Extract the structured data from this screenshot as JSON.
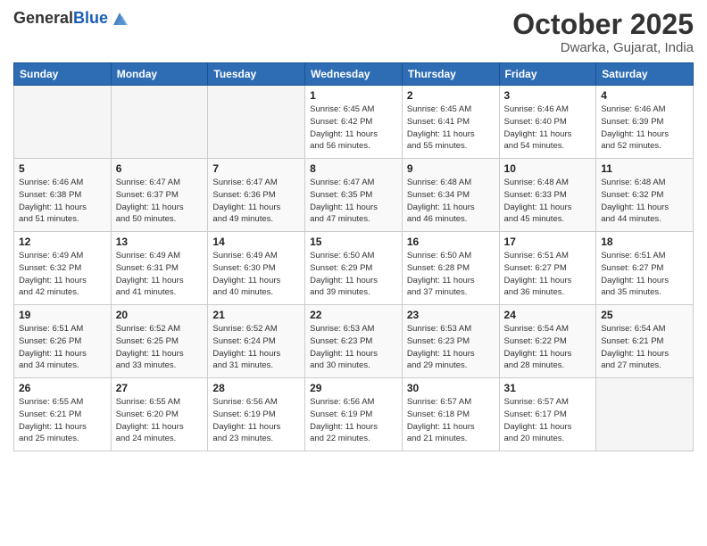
{
  "logo": {
    "general": "General",
    "blue": "Blue"
  },
  "title": "October 2025",
  "location": "Dwarka, Gujarat, India",
  "days_of_week": [
    "Sunday",
    "Monday",
    "Tuesday",
    "Wednesday",
    "Thursday",
    "Friday",
    "Saturday"
  ],
  "weeks": [
    [
      {
        "day": "",
        "info": ""
      },
      {
        "day": "",
        "info": ""
      },
      {
        "day": "",
        "info": ""
      },
      {
        "day": "1",
        "info": "Sunrise: 6:45 AM\nSunset: 6:42 PM\nDaylight: 11 hours\nand 56 minutes."
      },
      {
        "day": "2",
        "info": "Sunrise: 6:45 AM\nSunset: 6:41 PM\nDaylight: 11 hours\nand 55 minutes."
      },
      {
        "day": "3",
        "info": "Sunrise: 6:46 AM\nSunset: 6:40 PM\nDaylight: 11 hours\nand 54 minutes."
      },
      {
        "day": "4",
        "info": "Sunrise: 6:46 AM\nSunset: 6:39 PM\nDaylight: 11 hours\nand 52 minutes."
      }
    ],
    [
      {
        "day": "5",
        "info": "Sunrise: 6:46 AM\nSunset: 6:38 PM\nDaylight: 11 hours\nand 51 minutes."
      },
      {
        "day": "6",
        "info": "Sunrise: 6:47 AM\nSunset: 6:37 PM\nDaylight: 11 hours\nand 50 minutes."
      },
      {
        "day": "7",
        "info": "Sunrise: 6:47 AM\nSunset: 6:36 PM\nDaylight: 11 hours\nand 49 minutes."
      },
      {
        "day": "8",
        "info": "Sunrise: 6:47 AM\nSunset: 6:35 PM\nDaylight: 11 hours\nand 47 minutes."
      },
      {
        "day": "9",
        "info": "Sunrise: 6:48 AM\nSunset: 6:34 PM\nDaylight: 11 hours\nand 46 minutes."
      },
      {
        "day": "10",
        "info": "Sunrise: 6:48 AM\nSunset: 6:33 PM\nDaylight: 11 hours\nand 45 minutes."
      },
      {
        "day": "11",
        "info": "Sunrise: 6:48 AM\nSunset: 6:32 PM\nDaylight: 11 hours\nand 44 minutes."
      }
    ],
    [
      {
        "day": "12",
        "info": "Sunrise: 6:49 AM\nSunset: 6:32 PM\nDaylight: 11 hours\nand 42 minutes."
      },
      {
        "day": "13",
        "info": "Sunrise: 6:49 AM\nSunset: 6:31 PM\nDaylight: 11 hours\nand 41 minutes."
      },
      {
        "day": "14",
        "info": "Sunrise: 6:49 AM\nSunset: 6:30 PM\nDaylight: 11 hours\nand 40 minutes."
      },
      {
        "day": "15",
        "info": "Sunrise: 6:50 AM\nSunset: 6:29 PM\nDaylight: 11 hours\nand 39 minutes."
      },
      {
        "day": "16",
        "info": "Sunrise: 6:50 AM\nSunset: 6:28 PM\nDaylight: 11 hours\nand 37 minutes."
      },
      {
        "day": "17",
        "info": "Sunrise: 6:51 AM\nSunset: 6:27 PM\nDaylight: 11 hours\nand 36 minutes."
      },
      {
        "day": "18",
        "info": "Sunrise: 6:51 AM\nSunset: 6:27 PM\nDaylight: 11 hours\nand 35 minutes."
      }
    ],
    [
      {
        "day": "19",
        "info": "Sunrise: 6:51 AM\nSunset: 6:26 PM\nDaylight: 11 hours\nand 34 minutes."
      },
      {
        "day": "20",
        "info": "Sunrise: 6:52 AM\nSunset: 6:25 PM\nDaylight: 11 hours\nand 33 minutes."
      },
      {
        "day": "21",
        "info": "Sunrise: 6:52 AM\nSunset: 6:24 PM\nDaylight: 11 hours\nand 31 minutes."
      },
      {
        "day": "22",
        "info": "Sunrise: 6:53 AM\nSunset: 6:23 PM\nDaylight: 11 hours\nand 30 minutes."
      },
      {
        "day": "23",
        "info": "Sunrise: 6:53 AM\nSunset: 6:23 PM\nDaylight: 11 hours\nand 29 minutes."
      },
      {
        "day": "24",
        "info": "Sunrise: 6:54 AM\nSunset: 6:22 PM\nDaylight: 11 hours\nand 28 minutes."
      },
      {
        "day": "25",
        "info": "Sunrise: 6:54 AM\nSunset: 6:21 PM\nDaylight: 11 hours\nand 27 minutes."
      }
    ],
    [
      {
        "day": "26",
        "info": "Sunrise: 6:55 AM\nSunset: 6:21 PM\nDaylight: 11 hours\nand 25 minutes."
      },
      {
        "day": "27",
        "info": "Sunrise: 6:55 AM\nSunset: 6:20 PM\nDaylight: 11 hours\nand 24 minutes."
      },
      {
        "day": "28",
        "info": "Sunrise: 6:56 AM\nSunset: 6:19 PM\nDaylight: 11 hours\nand 23 minutes."
      },
      {
        "day": "29",
        "info": "Sunrise: 6:56 AM\nSunset: 6:19 PM\nDaylight: 11 hours\nand 22 minutes."
      },
      {
        "day": "30",
        "info": "Sunrise: 6:57 AM\nSunset: 6:18 PM\nDaylight: 11 hours\nand 21 minutes."
      },
      {
        "day": "31",
        "info": "Sunrise: 6:57 AM\nSunset: 6:17 PM\nDaylight: 11 hours\nand 20 minutes."
      },
      {
        "day": "",
        "info": ""
      }
    ]
  ]
}
